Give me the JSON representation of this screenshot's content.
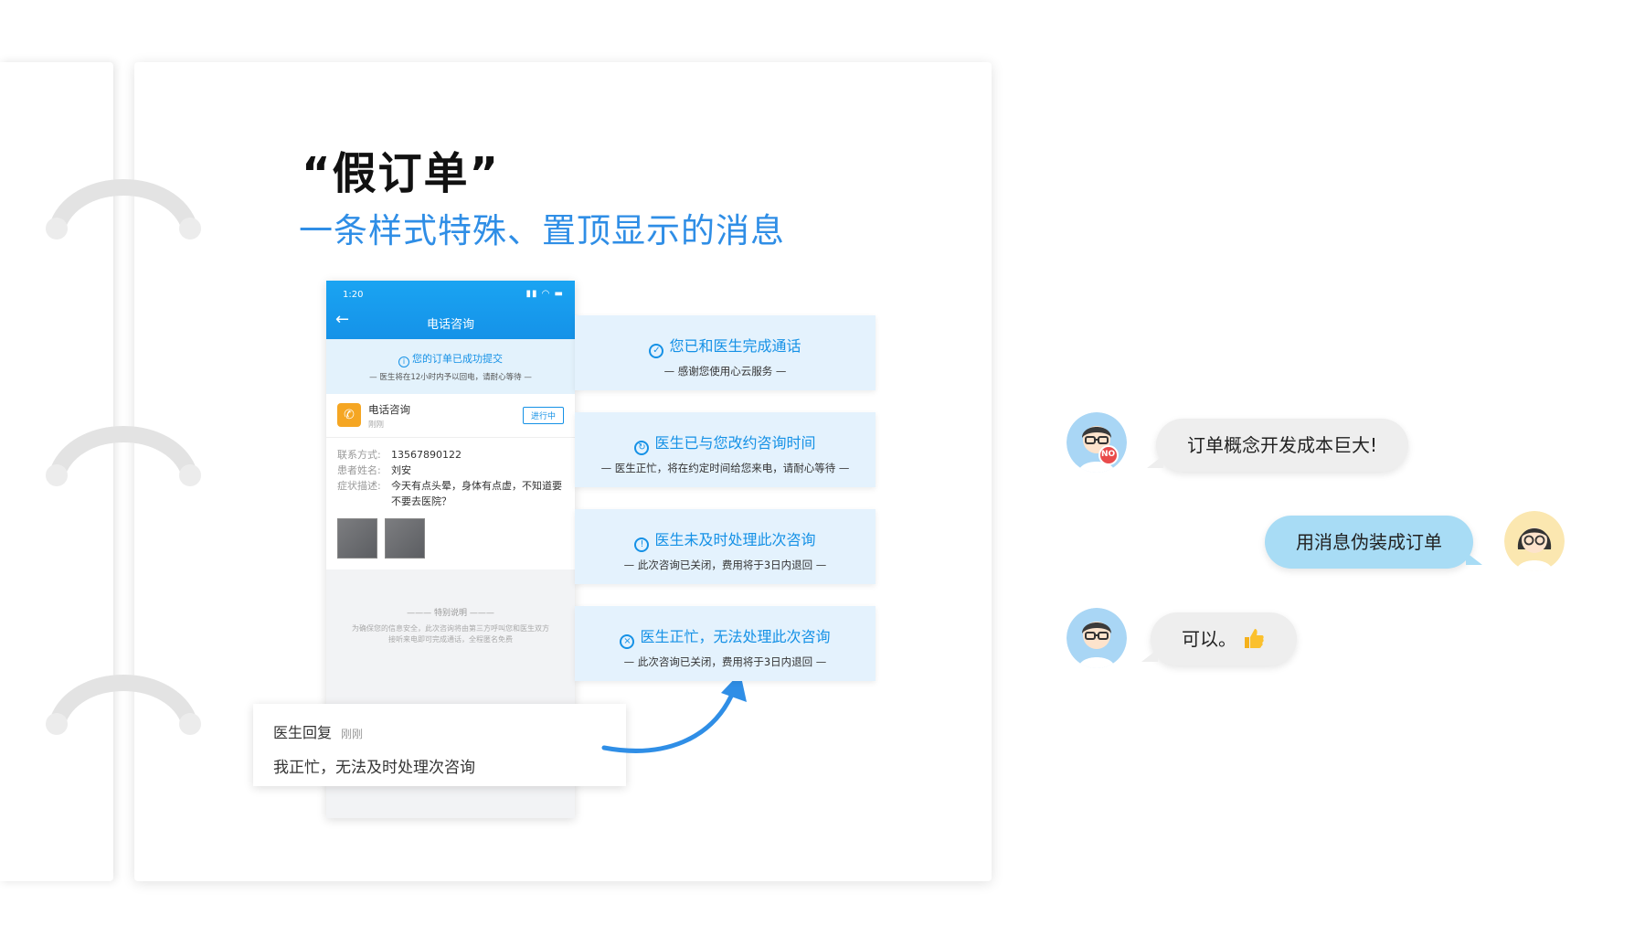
{
  "slide": {
    "title": "“假订单”",
    "subtitle": "一条样式特殊、置顶显示的消息"
  },
  "phone": {
    "status_time": "1:20",
    "status_icons": "▮▮ ◠ ▬",
    "title": "电话咨询",
    "notice": {
      "title": "您的订单已成功提交",
      "subtitle": "— 医生将在12小时内予以回电，请耐心等待 —"
    },
    "order": {
      "name": "电话咨询",
      "time": "刚刚",
      "status": "进行中"
    },
    "info": [
      {
        "label": "联系方式:",
        "value": "13567890122"
      },
      {
        "label": "患者姓名:",
        "value": "刘安"
      },
      {
        "label": "症状描述:",
        "value": "今天有点头晕，身体有点虚，不知道要不要去医院？"
      }
    ],
    "special_title": "——— 特别说明 ———",
    "special_text": "为确保您的信息安全，此次咨询将由第三方呼叫您和医生双方接听来电即可完成通话，全程匿名免费"
  },
  "reply": {
    "sender": "医生回复",
    "time": "刚刚",
    "message": "我正忙，无法及时处理次咨询"
  },
  "status_cards": [
    {
      "icon": "check-circle-icon",
      "glyph": "✓",
      "main": "您已和医生完成通话",
      "sub": "— 感谢您使用心云服务 —"
    },
    {
      "icon": "reschedule-icon",
      "glyph": "↻",
      "main": "医生已与您改约咨询时间",
      "sub": "— 医生正忙，将在约定时间给您来电，请耐心等待 —"
    },
    {
      "icon": "alert-circle-icon",
      "glyph": "!",
      "main": "医生未及时处理此次咨询",
      "sub": "— 此次咨询已关闭，费用将于3日内退回 —"
    },
    {
      "icon": "close-circle-icon",
      "glyph": "×",
      "main": "医生正忙，无法处理此次咨询",
      "sub": "— 此次咨询已关闭，费用将于3日内退回 —"
    }
  ],
  "chat": [
    {
      "side": "left",
      "text": "订单概念开发成本巨大!"
    },
    {
      "side": "right",
      "text": "用消息伪装成订单"
    },
    {
      "side": "left",
      "text": "可以。"
    }
  ],
  "colors": {
    "accent": "#1591e6",
    "card_bg": "#e4f2fd",
    "bubble_right": "#a8dcf5",
    "bubble_left": "#eeeeee"
  }
}
